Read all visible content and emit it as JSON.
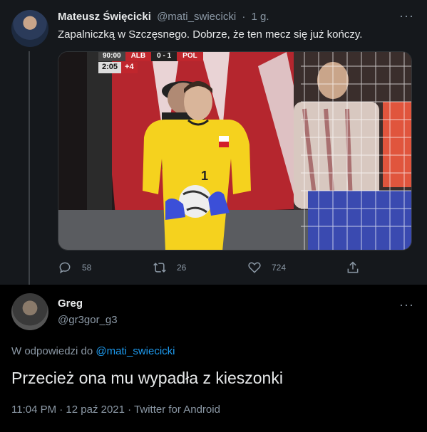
{
  "tweet1": {
    "name": "Mateusz Święcicki",
    "handle": "@mati_swiecicki",
    "separator": "·",
    "time": "1 g.",
    "more": "···",
    "text": "Zapalniczką w Szczęsnego. Dobrze, że ten mecz się już kończy.",
    "media": {
      "scoreboard": {
        "time": "90:00",
        "team1": "ALB",
        "score": "0 - 1",
        "team2": "POL"
      },
      "clock": {
        "time": "2:05",
        "added": "+4"
      },
      "jersey_number": "1"
    },
    "stats": {
      "replies": "58",
      "retweets": "26",
      "likes": "724"
    }
  },
  "tweet2": {
    "name": "Greg",
    "handle": "@gr3gor_g3",
    "more": "···",
    "reply_prefix": "W odpowiedzi do",
    "reply_to": "@mati_swiecicki",
    "text": "Przecież ona mu wypadła z kieszonki",
    "meta": "11:04 PM · 12 paź 2021 · Twitter for Android"
  },
  "colors": {
    "background": "#15181c",
    "accent": "#1d9bf0",
    "secondary_text": "#8b98a5",
    "primary_text": "#e7e9ea",
    "jersey": "#f5d21e"
  }
}
